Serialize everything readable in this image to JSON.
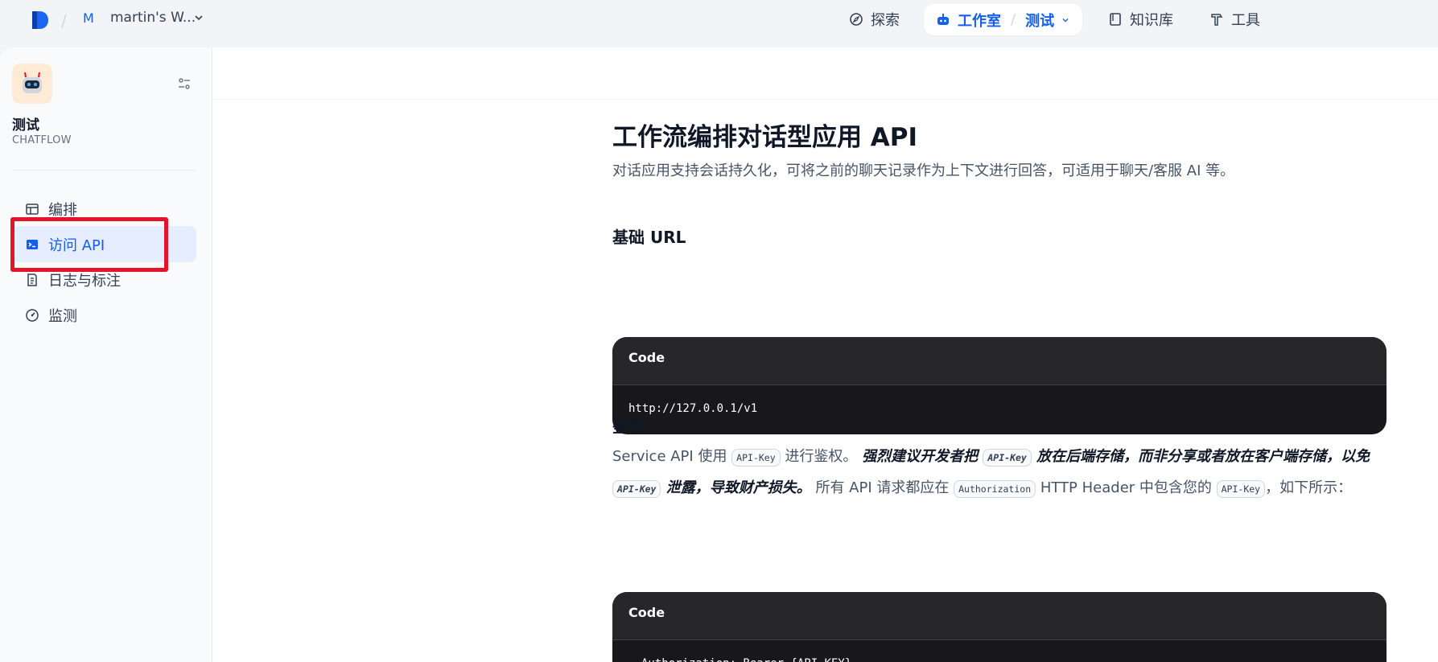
{
  "topbar": {
    "workspace_avatar": "M",
    "workspace_name": "martin's W...",
    "nav": {
      "explore": "探索",
      "studio": "工作室",
      "current_app": "测试",
      "knowledge": "知识库",
      "tools": "工具"
    }
  },
  "sidebar": {
    "app_name": "测试",
    "app_type": "CHATFLOW",
    "items": [
      {
        "label": "编排",
        "icon": "layout-icon"
      },
      {
        "label": "访问 API",
        "icon": "terminal-icon",
        "active": true
      },
      {
        "label": "日志与标注",
        "icon": "file-list-icon"
      },
      {
        "label": "监测",
        "icon": "dashboard-icon"
      }
    ]
  },
  "doc": {
    "title": "工作流编排对话型应用 API",
    "lead": "对话应用支持会话持久化，可将之前的聊天记录作为上下文进行回答，可适用于聊天/客服 AI 等。",
    "base_url_heading": "基础 URL",
    "code1_label": "Code",
    "base_url": "http://127.0.0.1/v1",
    "auth_heading": "鉴权",
    "auth_para": {
      "t1": "Service API 使用 ",
      "c1": "API-Key",
      "t2": " 进行鉴权。 ",
      "s1": "强烈建议开发者把 ",
      "c2": "API-Key",
      "s2": " 放在后端存储，而非分享或者放在客户端存储，以免 ",
      "c3": "API-Key",
      "s3": " 泄露，导致财产损失。",
      "t3": " 所有 API 请求都应在 ",
      "c4": "Authorization",
      "t4": " HTTP Header 中包含您的 ",
      "c5": "API-Key",
      "t5": "，如下所示："
    },
    "code2_label": "Code",
    "auth_header": "Authorization: Bearer {API_KEY}"
  },
  "colors": {
    "accent": "#155eef",
    "highlight_box": "#e5132c",
    "code_bg": "#18181b"
  }
}
